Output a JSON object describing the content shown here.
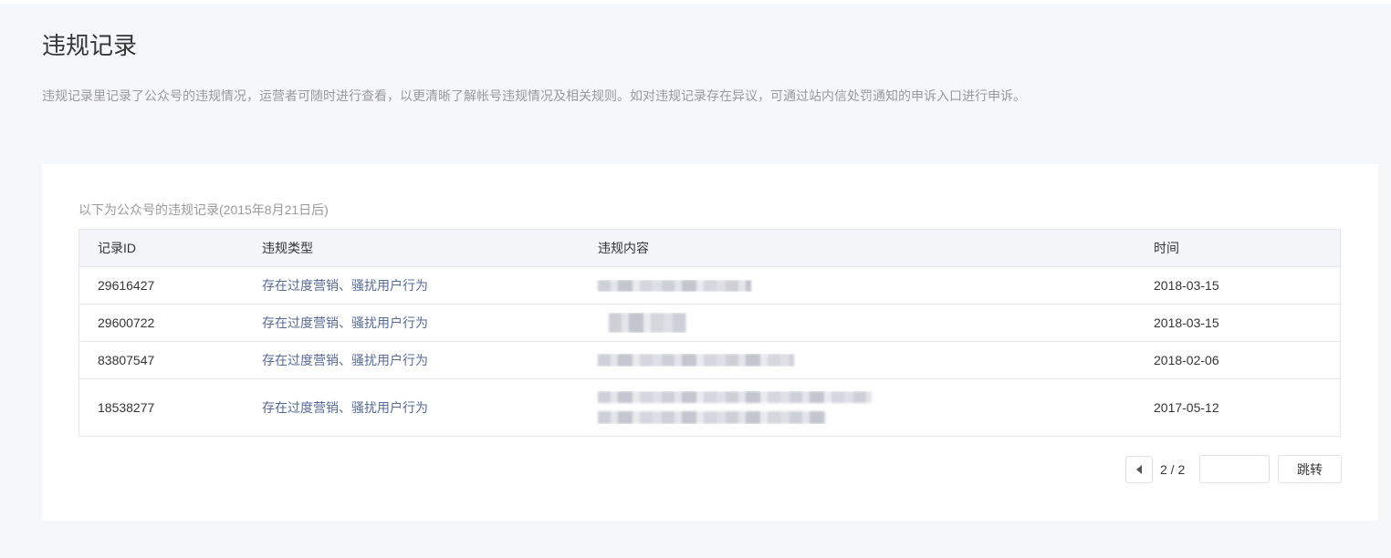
{
  "header": {
    "title": "违规记录",
    "description": "违规记录里记录了公众号的违规情况，运营者可随时进行查看，以更清晰了解帐号违规情况及相关规则。如对违规记录存在异议，可通过站内信处罚通知的申诉入口进行申诉。"
  },
  "records": {
    "subtitle": "以下为公众号的违规记录(2015年8月21日后)",
    "columns": [
      "记录ID",
      "违规类型",
      "违规内容",
      "时间"
    ],
    "rows": [
      {
        "id": "29616427",
        "type": "存在过度营销、骚扰用户行为",
        "time": "2018-03-15"
      },
      {
        "id": "29600722",
        "type": "存在过度营销、骚扰用户行为",
        "time": "2018-03-15"
      },
      {
        "id": "83807547",
        "type": "存在过度营销、骚扰用户行为",
        "time": "2018-02-06"
      },
      {
        "id": "18538277",
        "type": "存在过度营销、骚扰用户行为",
        "time": "2017-05-12"
      }
    ]
  },
  "pagination": {
    "prev_icon": "caret-left-icon",
    "page_indicator": "2 / 2",
    "jump_label": "跳转"
  },
  "colors": {
    "page_background": "#f6f7f9",
    "card_background": "#ffffff",
    "table_header_background": "#f4f5f9",
    "border": "#e4e6eb",
    "text_primary": "#353535",
    "text_muted": "#9a9a9a",
    "type_text": "#576b95"
  }
}
